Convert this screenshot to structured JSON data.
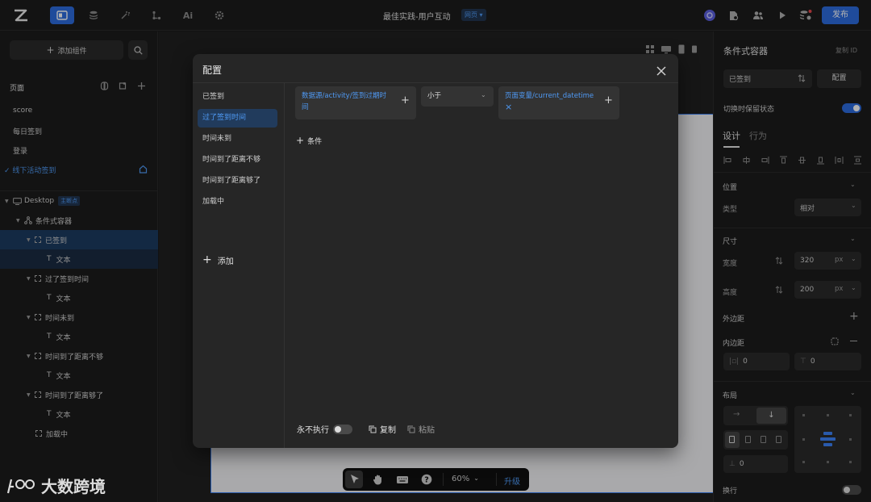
{
  "topbar": {
    "title": "最佳实践-用户互动",
    "badge": "网页",
    "publish_label": "发布",
    "icons": [
      "logo-icon",
      "pages-icon",
      "database-icon",
      "magic-icon",
      "flow-icon",
      "ai-icon",
      "settings-icon"
    ],
    "ai_label": "Ai",
    "brand_color": "#2d6cdf"
  },
  "left": {
    "add_component_label": "添加组件",
    "pages_heading": "页面",
    "pages": [
      "score",
      "每日签到",
      "登录",
      "线下活动签到"
    ],
    "tree": {
      "root": "Desktop",
      "root_badge": "主断点",
      "container": "条件式容器",
      "items": [
        {
          "label": "已签到",
          "child": "文本"
        },
        {
          "label": "过了签到时间",
          "child": "文本"
        },
        {
          "label": "时间未到",
          "child": "文本"
        },
        {
          "label": "时间到了距离不够",
          "child": "文本"
        },
        {
          "label": "时间到了距离够了",
          "child": "文本"
        }
      ],
      "loading": "加载中"
    }
  },
  "modal": {
    "title": "配置",
    "conditions": [
      "已签到",
      "过了签到时间",
      "时间未到",
      "时间到了距离不够",
      "时间到了距离够了",
      "加载中"
    ],
    "add_label": "添加",
    "rule": {
      "left_line1": "数据源/activity/签到过期时",
      "left_line2": "间",
      "operator": "小于",
      "right_value": "页面变量/current_datetime"
    },
    "add_rule_label": "条件",
    "never_run_label": "永不执行",
    "copy_label": "复制",
    "paste_label": "粘贴"
  },
  "canvas": {
    "zoom": "60%",
    "upgrade_label": "升级"
  },
  "right": {
    "title": "条件式容器",
    "copy_id": "复制 ID",
    "state_select": "已签到",
    "config_button": "配置",
    "keep_state_label": "切换时保留状态",
    "tab_design": "设计",
    "tab_behavior": "行为",
    "position_heading": "位置",
    "type_label": "类型",
    "type_value": "相对",
    "size_heading": "尺寸",
    "width_label": "宽度",
    "width_value": "320",
    "height_label": "高度",
    "height_value": "200",
    "unit": "px",
    "margin_label": "外边距",
    "padding_label": "内边距",
    "padding_x": "0",
    "padding_y": "0",
    "layout_heading": "布局",
    "gap_value": "0",
    "wrap_label": "换行"
  },
  "watermark": {
    "text": "大数跨境"
  }
}
